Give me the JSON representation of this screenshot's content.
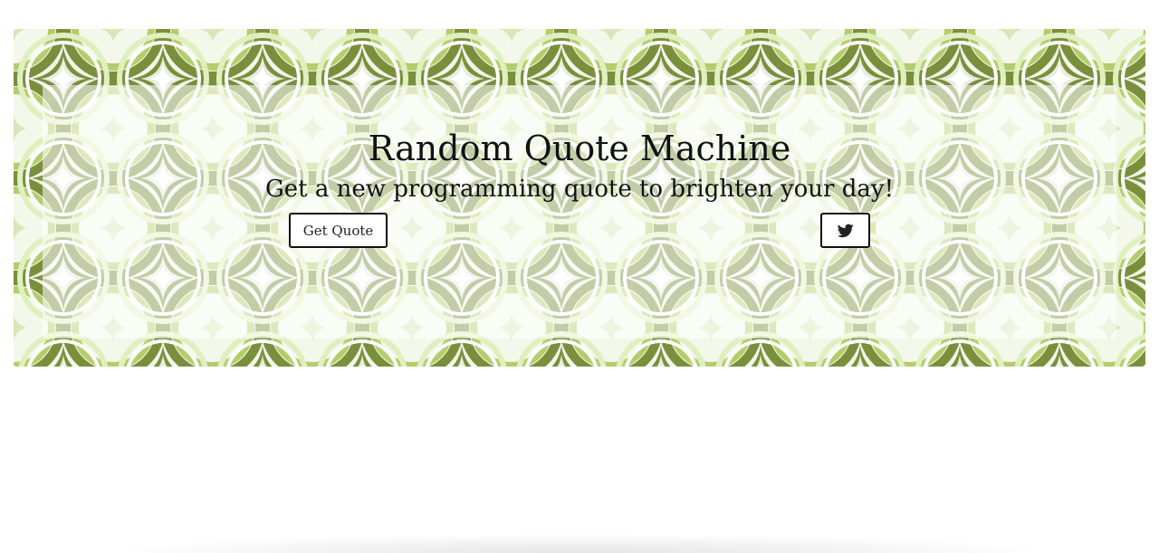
{
  "header": {
    "title": "Random Quote Machine",
    "subtitle": "Get a new programming quote to brighten your day!"
  },
  "actions": {
    "get_quote_label": "Get Quote",
    "tweet_icon": "twitter-icon"
  },
  "colors": {
    "pattern_dark_green": "#7a8f3c",
    "pattern_light_green": "#b5cc6b",
    "pattern_pale": "#e8f3d3",
    "pattern_grey": "#c9cec0",
    "text": "#111111",
    "button_border": "#111111",
    "background": "#ffffff"
  }
}
